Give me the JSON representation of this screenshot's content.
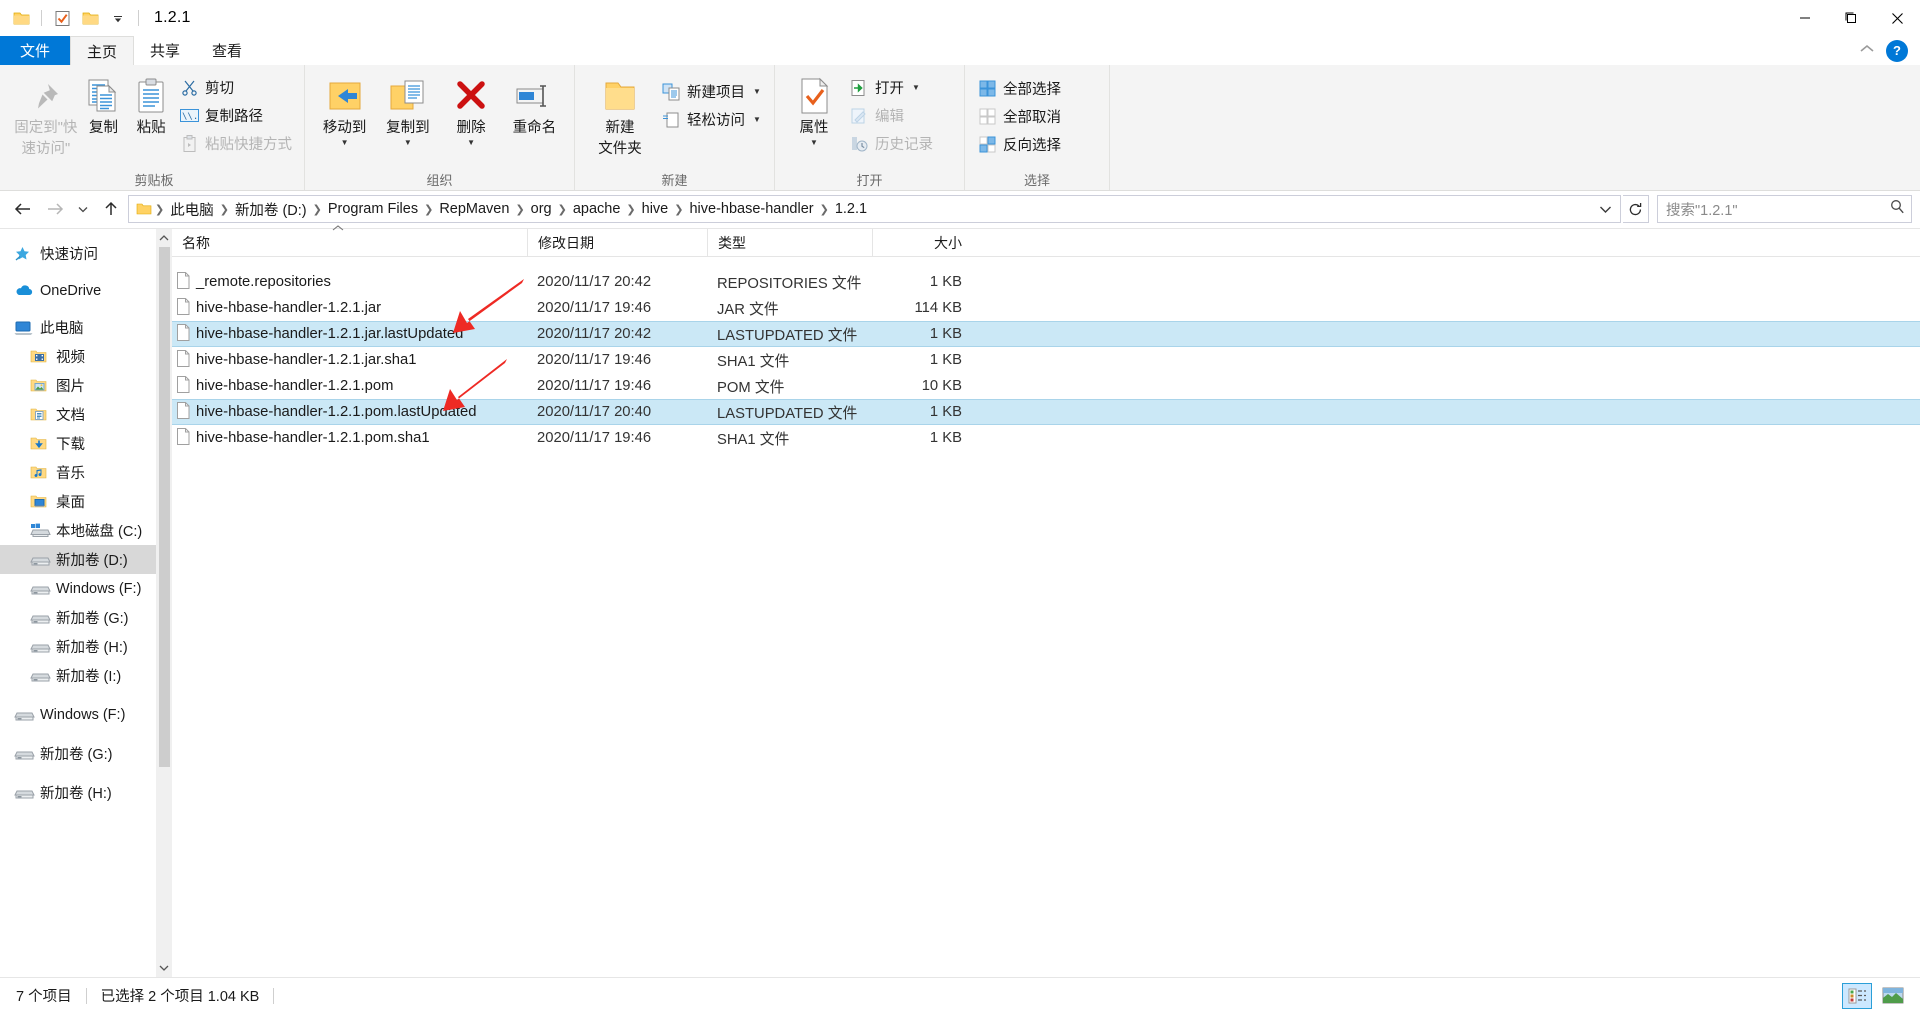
{
  "window": {
    "title": "1.2.1",
    "minimize_label": "最小化",
    "maximize_label": "最大化",
    "close_label": "关闭"
  },
  "quick_access_toolbar": {
    "items": [
      {
        "name": "folder-icon",
        "label": "属性"
      },
      {
        "name": "checkbox-properties-icon",
        "label": "新建文件夹"
      },
      {
        "name": "folder-new-icon",
        "label": "新建文件夹"
      },
      {
        "name": "chevron-down-icon",
        "label": "自定义快速访问工具栏"
      }
    ]
  },
  "tabs": [
    {
      "id": "file",
      "label": "文件"
    },
    {
      "id": "home",
      "label": "主页"
    },
    {
      "id": "share",
      "label": "共享"
    },
    {
      "id": "view",
      "label": "查看"
    }
  ],
  "ribbon_right": {
    "collapse_label": "折叠功能区",
    "help_label": "?"
  },
  "ribbon": {
    "groups": [
      {
        "label": "剪贴板",
        "big": [
          {
            "label_line1": "固定到\"快",
            "label_line2": "速访问\"",
            "icon": "pin-icon",
            "disabled": true
          },
          {
            "label_line1": "复制",
            "label_line2": "",
            "icon": "copy-icon",
            "disabled": false
          },
          {
            "label_line1": "粘贴",
            "label_line2": "",
            "icon": "paste-icon",
            "disabled": false
          }
        ],
        "small": [
          {
            "label": "剪切",
            "icon": "scissors-icon",
            "disabled": false
          },
          {
            "label": "复制路径",
            "icon": "copy-path-icon",
            "disabled": false
          },
          {
            "label": "粘贴快捷方式",
            "icon": "paste-shortcut-icon",
            "disabled": true
          }
        ]
      },
      {
        "label": "组织",
        "big": [
          {
            "label_line1": "移动到",
            "label_line2": "",
            "icon": "move-to-icon",
            "caret": true
          },
          {
            "label_line1": "复制到",
            "label_line2": "",
            "icon": "copy-to-icon",
            "caret": true
          },
          {
            "label_line1": "删除",
            "label_line2": "",
            "icon": "delete-icon",
            "caret": true
          },
          {
            "label_line1": "重命名",
            "label_line2": "",
            "icon": "rename-icon",
            "caret": false
          }
        ],
        "small": []
      },
      {
        "label": "新建",
        "big": [
          {
            "label_line1": "新建",
            "label_line2": "文件夹",
            "icon": "new-folder-icon",
            "caret": false
          }
        ],
        "small": [
          {
            "label": "新建项目",
            "icon": "new-item-icon",
            "caret": true
          },
          {
            "label": "轻松访问",
            "icon": "easy-access-icon",
            "caret": true
          }
        ]
      },
      {
        "label": "打开",
        "big": [
          {
            "label_line1": "属性",
            "label_line2": "",
            "icon": "properties-icon",
            "caret": true
          }
        ],
        "small": [
          {
            "label": "打开",
            "icon": "open-icon",
            "caret": true,
            "disabled": false
          },
          {
            "label": "编辑",
            "icon": "edit-icon",
            "caret": false,
            "disabled": true
          },
          {
            "label": "历史记录",
            "icon": "history-icon",
            "caret": false,
            "disabled": true
          }
        ]
      },
      {
        "label": "选择",
        "big": [],
        "small": [
          {
            "label": "全部选择",
            "icon": "select-all-icon",
            "disabled": false
          },
          {
            "label": "全部取消",
            "icon": "select-none-icon",
            "disabled": true
          },
          {
            "label": "反向选择",
            "icon": "invert-selection-icon",
            "disabled": false
          }
        ]
      }
    ]
  },
  "address_bar": {
    "back_label": "后退",
    "forward_label": "前进",
    "recent_label": "最近浏览的位置",
    "up_label": "向上",
    "breadcrumbs": [
      "此电脑",
      "新加卷 (D:)",
      "Program Files",
      "RepMaven",
      "org",
      "apache",
      "hive",
      "hive-hbase-handler",
      "1.2.1"
    ],
    "dropdown_label": "以前的位置",
    "refresh_label": "刷新",
    "search_placeholder": "搜索\"1.2.1\""
  },
  "sidebar": {
    "items": [
      {
        "label": "快速访问",
        "icon": "star-pin-icon",
        "indent": 0,
        "selected": false
      },
      {
        "label": "OneDrive",
        "icon": "onedrive-cloud-icon",
        "indent": 0,
        "selected": false
      },
      {
        "label": "此电脑",
        "icon": "this-pc-icon",
        "indent": 0,
        "selected": false
      },
      {
        "label": "视频",
        "icon": "videos-folder-icon",
        "indent": 1,
        "selected": false
      },
      {
        "label": "图片",
        "icon": "pictures-folder-icon",
        "indent": 1,
        "selected": false
      },
      {
        "label": "文档",
        "icon": "documents-folder-icon",
        "indent": 1,
        "selected": false
      },
      {
        "label": "下载",
        "icon": "downloads-folder-icon",
        "indent": 1,
        "selected": false
      },
      {
        "label": "音乐",
        "icon": "music-folder-icon",
        "indent": 1,
        "selected": false
      },
      {
        "label": "桌面",
        "icon": "desktop-folder-icon",
        "indent": 1,
        "selected": false
      },
      {
        "label": "本地磁盘 (C:)",
        "icon": "windows-drive-icon",
        "indent": 1,
        "selected": false
      },
      {
        "label": "新加卷 (D:)",
        "icon": "drive-icon",
        "indent": 1,
        "selected": true
      },
      {
        "label": "Windows (F:)",
        "icon": "drive-icon",
        "indent": 1,
        "selected": false
      },
      {
        "label": "新加卷 (G:)",
        "icon": "drive-icon",
        "indent": 1,
        "selected": false
      },
      {
        "label": "新加卷 (H:)",
        "icon": "drive-icon",
        "indent": 1,
        "selected": false
      },
      {
        "label": "新加卷 (I:)",
        "icon": "drive-icon",
        "indent": 1,
        "selected": false
      },
      {
        "label": "Windows (F:)",
        "icon": "drive-icon",
        "indent": 0,
        "selected": false
      },
      {
        "label": "新加卷 (G:)",
        "icon": "drive-icon",
        "indent": 0,
        "selected": false
      },
      {
        "label": "新加卷 (H:)",
        "icon": "drive-icon",
        "indent": 0,
        "selected": false
      }
    ]
  },
  "file_list": {
    "columns": [
      {
        "key": "name",
        "label": "名称",
        "sorted": true
      },
      {
        "key": "date",
        "label": "修改日期"
      },
      {
        "key": "type",
        "label": "类型"
      },
      {
        "key": "size",
        "label": "大小"
      }
    ],
    "rows": [
      {
        "name": "_remote.repositories",
        "date": "2020/11/17 20:42",
        "type": "REPOSITORIES 文件",
        "size": "1 KB",
        "selected": false
      },
      {
        "name": "hive-hbase-handler-1.2.1.jar",
        "date": "2020/11/17 19:46",
        "type": "JAR 文件",
        "size": "114 KB",
        "selected": false
      },
      {
        "name": "hive-hbase-handler-1.2.1.jar.lastUpdated",
        "date": "2020/11/17 20:42",
        "type": "LASTUPDATED 文件",
        "size": "1 KB",
        "selected": true
      },
      {
        "name": "hive-hbase-handler-1.2.1.jar.sha1",
        "date": "2020/11/17 19:46",
        "type": "SHA1 文件",
        "size": "1 KB",
        "selected": false
      },
      {
        "name": "hive-hbase-handler-1.2.1.pom",
        "date": "2020/11/17 19:46",
        "type": "POM 文件",
        "size": "10 KB",
        "selected": false
      },
      {
        "name": "hive-hbase-handler-1.2.1.pom.lastUpdated",
        "date": "2020/11/17 20:40",
        "type": "LASTUPDATED 文件",
        "size": "1 KB",
        "selected": true
      },
      {
        "name": "hive-hbase-handler-1.2.1.pom.sha1",
        "date": "2020/11/17 19:46",
        "type": "SHA1 文件",
        "size": "1 KB",
        "selected": false
      }
    ]
  },
  "status_bar": {
    "item_count": "7 个项目",
    "selection": "已选择 2 个项目  1.04 KB",
    "details_view_label": "详细信息",
    "large_icons_view_label": "大图标"
  },
  "annotations": {
    "arrow_color": "#ee2a24",
    "arrows": [
      {
        "target": "hive-hbase-handler-1.2.1.jar.lastUpdated"
      },
      {
        "target": "hive-hbase-handler-1.2.1.pom.lastUpdated"
      }
    ]
  }
}
